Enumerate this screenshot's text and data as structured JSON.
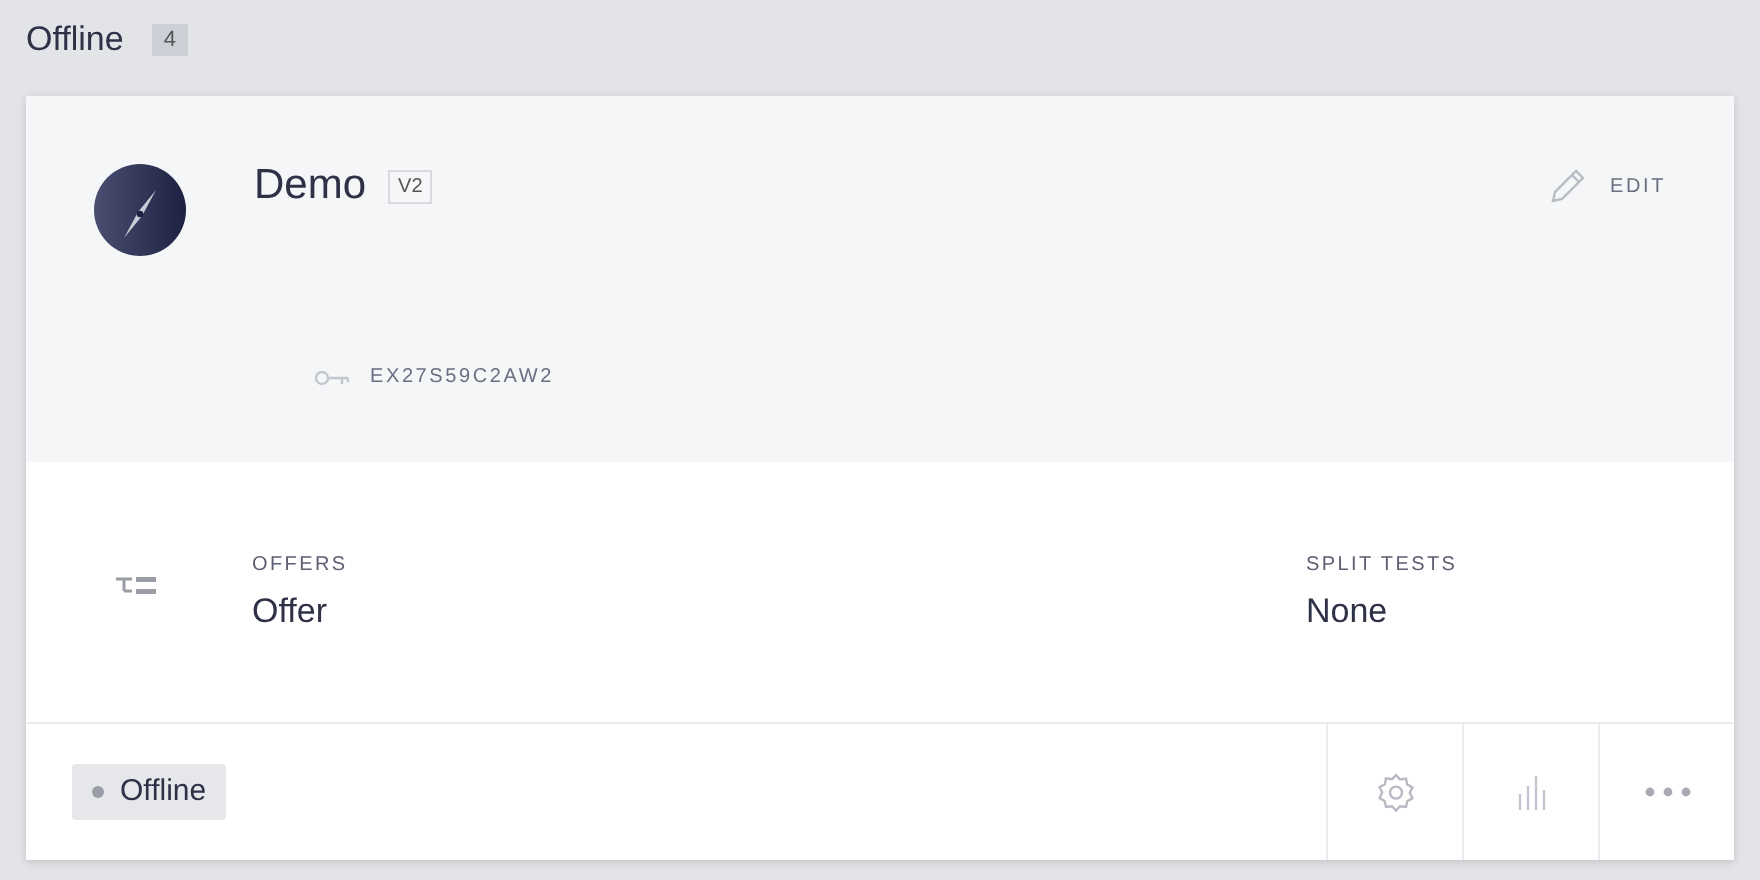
{
  "section": {
    "title": "Offline",
    "count": "4"
  },
  "card": {
    "name": "Demo",
    "version": "V2",
    "edit": "EDIT",
    "key": "EX27S59C2AW2",
    "fields": [
      {
        "label": "OFFERS",
        "value": "Offer"
      },
      {
        "label": "SPLIT TESTS",
        "value": "None"
      }
    ],
    "status": {
      "label": "Offline",
      "color": "#9a9ca6"
    },
    "actions": [
      {
        "kind": "settings"
      },
      {
        "kind": "stats"
      },
      {
        "kind": "more"
      }
    ]
  }
}
